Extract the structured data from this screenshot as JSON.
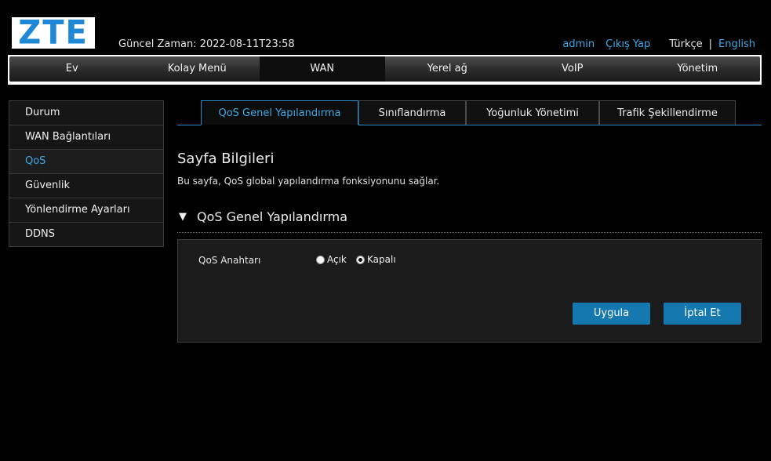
{
  "header": {
    "logo_text": "ZTE",
    "current_time": "Güncel Zaman: 2022-08-11T23:58",
    "user_link": "admin",
    "logout_link": "Çıkış Yap",
    "lang_current": "Türkçe",
    "lang_separator": "|",
    "lang_other": "English"
  },
  "nav": {
    "items": [
      "Ev",
      "Kolay Menü",
      "WAN",
      "Yerel ağ",
      "VoIP",
      "Yönetim"
    ],
    "active": "WAN"
  },
  "sidebar": {
    "items": [
      "Durum",
      "WAN Bağlantıları",
      "QoS",
      "Güvenlik",
      "Yönlendirme Ayarları",
      "DDNS"
    ],
    "active": "QoS"
  },
  "tabs": {
    "items": [
      "QoS Genel Yapılandırma",
      "Sınıflandırma",
      "Yoğunluk Yönetimi",
      "Trafik Şekillendirme"
    ],
    "active": "QoS Genel Yapılandırma"
  },
  "page": {
    "title": "Sayfa Bilgileri",
    "description": "Bu sayfa, QoS global yapılandırma fonksiyonunu sağlar.",
    "section_arrow": "▼",
    "section_title": "QoS Genel Yapılandırma"
  },
  "form": {
    "switch_label": "QoS Anahtarı",
    "option_on": "Açık",
    "option_off": "Kapalı",
    "selected": "Kapalı",
    "apply_button": "Uygula",
    "cancel_button": "İptal Et"
  },
  "colors": {
    "accent": "#3fa9e6",
    "button": "#1579b0",
    "background": "#000000"
  }
}
